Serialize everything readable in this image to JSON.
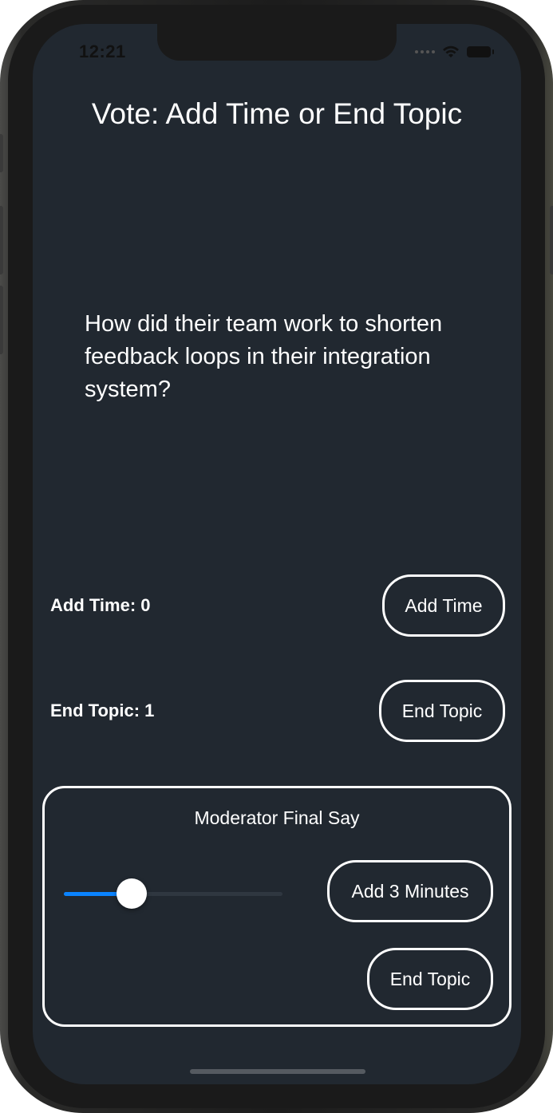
{
  "status_bar": {
    "time": "12:21"
  },
  "title": "Vote: Add Time or End Topic",
  "question": "How did their team work to shorten feedback loops in their integration system?",
  "votes": {
    "add_time_label": "Add Time: 0",
    "add_time_button": "Add Time",
    "end_topic_label": "End Topic: 1",
    "end_topic_button": "End Topic"
  },
  "moderator": {
    "title": "Moderator Final Say",
    "slider_value_fraction": 0.31,
    "add_minutes_button": "Add 3 Minutes",
    "end_topic_button": "End Topic"
  },
  "colors": {
    "background": "#212830",
    "accent": "#0a84ff",
    "text": "#ffffff"
  }
}
